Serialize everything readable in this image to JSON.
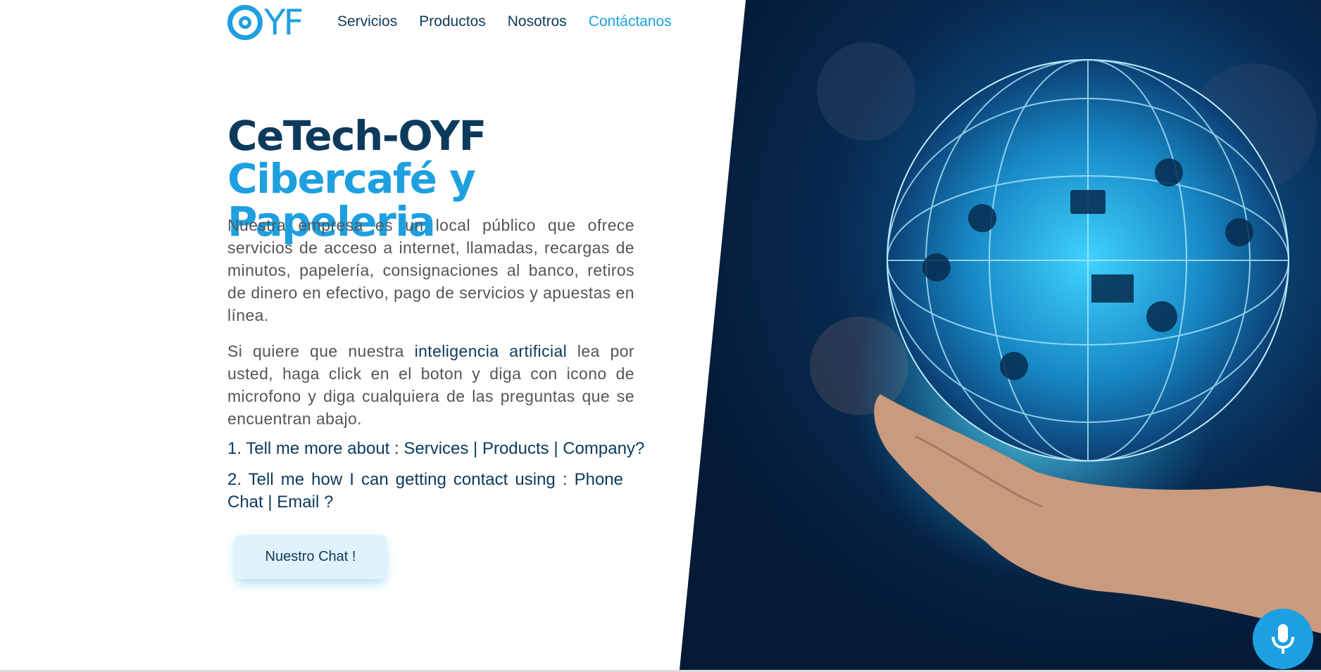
{
  "logo": {
    "text": "YF",
    "icon": "target-icon"
  },
  "nav": {
    "items": [
      {
        "label": "Servicios"
      },
      {
        "label": "Productos"
      },
      {
        "label": "Nosotros"
      },
      {
        "label": "Contáctanos"
      }
    ]
  },
  "hero": {
    "title_dark": "CeTech-OYF",
    "title_accent": "Cibercafé y Papeleria",
    "description": "Nuestra empresa es un local público que ofrece servicios de acceso a internet, llamadas, recargas de minutos, papelería, consignaciones al banco, retiros de dinero en efectivo, pago de servicios y apuestas en línea.",
    "ai_intro": "Si quiere que nuestra",
    "ai_highlight": "inteligencia artificial",
    "ai_rest": "lea por usted, haga click en el boton y diga con icono de microfono y diga cualquiera de las preguntas que se encuentran abajo.",
    "question_1": "1. Tell me more about : Services | Products | Company?",
    "question_2": "2. Tell me how I can getting contact using : Phone Chat | Email ?",
    "chat_button": "Nuestro Chat !"
  },
  "colors": {
    "accent": "#1ea0e0",
    "dark": "#0c3a5c",
    "text": "#555555"
  },
  "mic": {
    "icon": "microphone-icon"
  }
}
